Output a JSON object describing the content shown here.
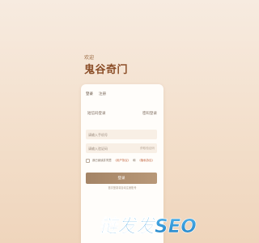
{
  "header": {
    "welcome": "欢迎",
    "title": "鬼谷奇门"
  },
  "tabs": [
    {
      "label": "登录",
      "active": true
    },
    {
      "label": "注册",
      "active": false
    }
  ],
  "login_modes": {
    "sms": "短信码登录",
    "password": "密码登录"
  },
  "form": {
    "phone_placeholder": "请输入手机号",
    "code_placeholder": "请输入验证码",
    "get_code": "获取验证码",
    "agree_prefix": "我已阅读并同意",
    "user_agreement": "《用户协议》",
    "agree_and": "和",
    "privacy_policy": "《隐私协议》",
    "submit": "登录",
    "footer_note": "首次登录将自动注册账号"
  },
  "watermark": {
    "text": "链发发SEO"
  },
  "colors": {
    "accent": "#8c4f29",
    "button": "#a48466",
    "link": "#c0603a",
    "watermark": "#2e93d4"
  }
}
